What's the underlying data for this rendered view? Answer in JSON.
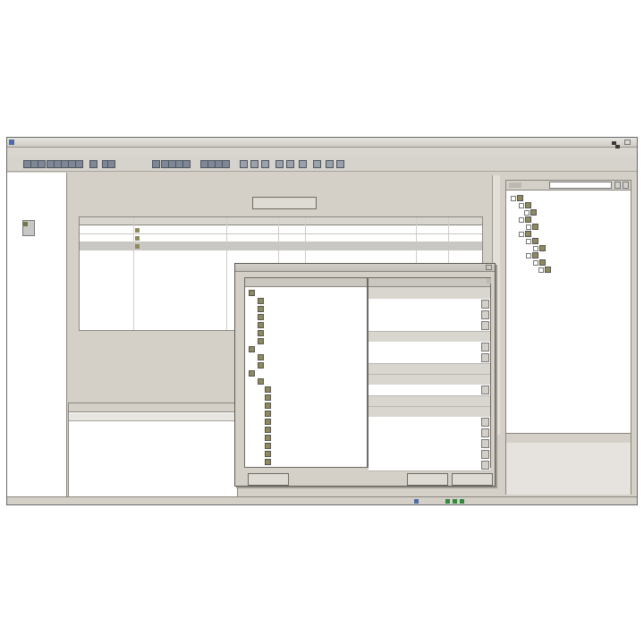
{
  "window": {
    "title": "",
    "menu": [
      "",
      "",
      "",
      "",
      "",
      "",
      "",
      ""
    ]
  },
  "toolbar": {
    "buttons": [
      "icon-1",
      "icon-2",
      "icon-3",
      "icon-4",
      "icon-5",
      "icon-6",
      "icon-7",
      "icon-8",
      "icon-9",
      "icon-10",
      "icon-11",
      "icon-12",
      "icon-13",
      "icon-14",
      "icon-15",
      "icon-16",
      "icon-17",
      "icon-18",
      "icon-19",
      "icon-20"
    ]
  },
  "left_pane": {
    "items": [
      "",
      "",
      "",
      "",
      ""
    ],
    "selected_index": 0
  },
  "center": {
    "header": "",
    "action_button": "",
    "table": {
      "columns": [
        "",
        "",
        "",
        "",
        "",
        "",
        ""
      ],
      "rows": [
        [
          "",
          "",
          "",
          "",
          "",
          "",
          ""
        ],
        [
          "",
          "",
          "",
          "",
          "",
          "",
          ""
        ],
        [
          "",
          "",
          "",
          "",
          "",
          "",
          ""
        ]
      ]
    }
  },
  "bottom_panel": {
    "header": "",
    "tab": ""
  },
  "right_pane": {
    "search_value": "",
    "tree": [
      "",
      "",
      "",
      "",
      "",
      "",
      "",
      "",
      "",
      "",
      ""
    ],
    "properties_header": ""
  },
  "dialog": {
    "title": "",
    "tree_header": "",
    "grid_header": "",
    "tree": [
      "",
      "",
      "",
      "",
      "",
      "",
      "",
      "",
      "",
      "",
      "",
      "",
      "",
      "",
      "",
      "",
      "",
      "",
      "",
      "",
      "",
      ""
    ],
    "grid": [
      "",
      "",
      "",
      "",
      "",
      "",
      "",
      "",
      "",
      "",
      "",
      "",
      "",
      "",
      "",
      "",
      ""
    ],
    "buttons": {
      "ok": "",
      "cancel": "",
      "help": ""
    }
  },
  "statusbar": {
    "text": ""
  },
  "colors": {
    "window_bg": "#d4d0c8",
    "selection": "#c9c7c4",
    "status_green": "#2e8b3a"
  },
  "icons": {
    "app": "app-icon",
    "folder": "folder-icon",
    "module": "module-icon",
    "scroll_arrow": "arrow-icon"
  }
}
